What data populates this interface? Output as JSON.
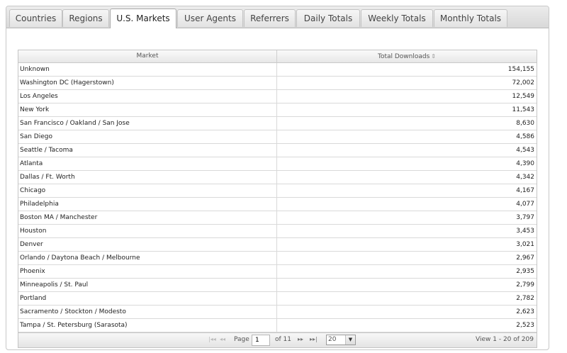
{
  "tabs": [
    {
      "label": "Countries",
      "active": false
    },
    {
      "label": "Regions",
      "active": false
    },
    {
      "label": "U.S. Markets",
      "active": true
    },
    {
      "label": "User Agents",
      "active": false
    },
    {
      "label": "Referrers",
      "active": false
    },
    {
      "label": "Daily Totals",
      "active": false
    },
    {
      "label": "Weekly Totals",
      "active": false
    },
    {
      "label": "Monthly Totals",
      "active": false
    }
  ],
  "grid": {
    "columns": {
      "market": "Market",
      "total": "Total Downloads"
    },
    "sort_icon": "sort-arrows-icon",
    "rows": [
      {
        "market": "Unknown",
        "total": "154,155"
      },
      {
        "market": "Washington DC (Hagerstown)",
        "total": "72,002"
      },
      {
        "market": "Los Angeles",
        "total": "12,549"
      },
      {
        "market": "New York",
        "total": "11,543"
      },
      {
        "market": "San Francisco / Oakland / San Jose",
        "total": "8,630"
      },
      {
        "market": "San Diego",
        "total": "4,586"
      },
      {
        "market": "Seattle / Tacoma",
        "total": "4,543"
      },
      {
        "market": "Atlanta",
        "total": "4,390"
      },
      {
        "market": "Dallas / Ft. Worth",
        "total": "4,342"
      },
      {
        "market": "Chicago",
        "total": "4,167"
      },
      {
        "market": "Philadelphia",
        "total": "4,077"
      },
      {
        "market": "Boston MA / Manchester",
        "total": "3,797"
      },
      {
        "market": "Houston",
        "total": "3,453"
      },
      {
        "market": "Denver",
        "total": "3,021"
      },
      {
        "market": "Orlando / Daytona Beach / Melbourne",
        "total": "2,967"
      },
      {
        "market": "Phoenix",
        "total": "2,935"
      },
      {
        "market": "Minneapolis / St. Paul",
        "total": "2,799"
      },
      {
        "market": "Portland",
        "total": "2,782"
      },
      {
        "market": "Sacramento / Stockton / Modesto",
        "total": "2,623"
      },
      {
        "market": "Tampa / St. Petersburg (Sarasota)",
        "total": "2,523"
      }
    ]
  },
  "pager": {
    "page_label": "Page",
    "page_value": "1",
    "of_label": "of 11",
    "per_page": "20",
    "view_info": "View 1 - 20 of 209"
  }
}
